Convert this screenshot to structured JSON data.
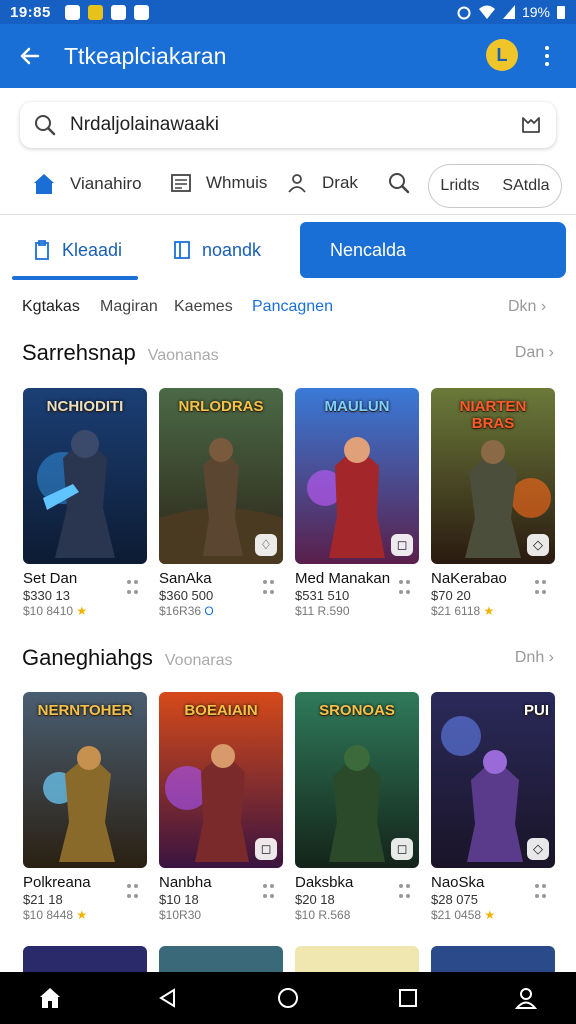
{
  "status_bar": {
    "time": "19:85",
    "battery": "19%"
  },
  "app_bar": {
    "title": "Ttkeaplciakaran",
    "coin_label": "L"
  },
  "search": {
    "text": "Nrdaljolainawaaki"
  },
  "quick_tabs": [
    {
      "label": "Vianahiro",
      "icon": "home-icon"
    },
    {
      "label": "Whmuis",
      "icon": "list-icon"
    },
    {
      "label": "Drak",
      "icon": "user-icon"
    }
  ],
  "quick_pill": {
    "left": "Lridts",
    "right": "SAtdla"
  },
  "segments": [
    {
      "label": "Kleaadi",
      "icon": "clipboard-icon"
    },
    {
      "label": "noandk",
      "icon": "book-icon"
    },
    {
      "label": "Nencalda",
      "active": true
    }
  ],
  "filters": {
    "items": [
      "Kgtakas",
      "Magiran",
      "Kaemes",
      "Pancagnen"
    ],
    "more": "Dkn"
  },
  "sections": [
    {
      "title": "Sarrehsnap",
      "subtitle": "Vaonanas",
      "more": "Dan",
      "cards": [
        {
          "art_title": "NCHIODITI",
          "name": "Set Dan",
          "price": "$330 13",
          "old": "$10 8410",
          "mark": "star"
        },
        {
          "art_title": "NRLODRAS",
          "name": "SanAka",
          "price": "$360 500",
          "old": "$16R36",
          "mark": "O"
        },
        {
          "art_title": "MAULUN",
          "name": "Med Manakan",
          "price": "$531 510",
          "old": "$11 R.590",
          "mark": ""
        },
        {
          "art_title": "NIARTEN BRAS",
          "name": "NaKerabao",
          "price": "$70 20",
          "old": "$21 6118",
          "mark": "star"
        }
      ]
    },
    {
      "title": "Ganeghiahgs",
      "subtitle": "Voonaras",
      "more": "Dnh",
      "cards": [
        {
          "art_title": "NERNTOHER",
          "name": "Polkreana",
          "price": "$21 18",
          "old": "$10 8448",
          "mark": "star"
        },
        {
          "art_title": "BOEAIAIN",
          "name": "Nanbha",
          "price": "$10 18",
          "old": "$10R30",
          "mark": ""
        },
        {
          "art_title": "SRONOAS",
          "name": "Daksbka",
          "price": "$20 18",
          "old": "$10 R.568",
          "mark": ""
        },
        {
          "art_title": "PUI",
          "name": "NaoSka",
          "price": "$28 075",
          "old": "$21 0458",
          "mark": "star"
        }
      ]
    }
  ],
  "colors": {
    "primary": "#1a6fd6",
    "status": "#1560c2",
    "star": "#f0b400"
  }
}
